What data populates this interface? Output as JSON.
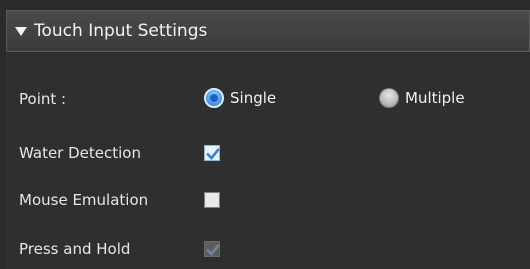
{
  "section": {
    "title": "Touch Input Settings"
  },
  "point": {
    "label": "Point :",
    "options": [
      {
        "label": "Single",
        "selected": true
      },
      {
        "label": "Multiple",
        "selected": false
      }
    ]
  },
  "water_detection": {
    "label": "Water Detection",
    "checked": true,
    "enabled": true
  },
  "mouse_emulation": {
    "label": "Mouse Emulation",
    "checked": false,
    "enabled": true
  },
  "press_and_hold": {
    "label": "Press and Hold",
    "checked": true,
    "enabled": false
  },
  "colors": {
    "background": "#2b2b2b",
    "header": "#3f3f3f",
    "accent": "#2e6fd0",
    "check": "#3f7fd1"
  }
}
